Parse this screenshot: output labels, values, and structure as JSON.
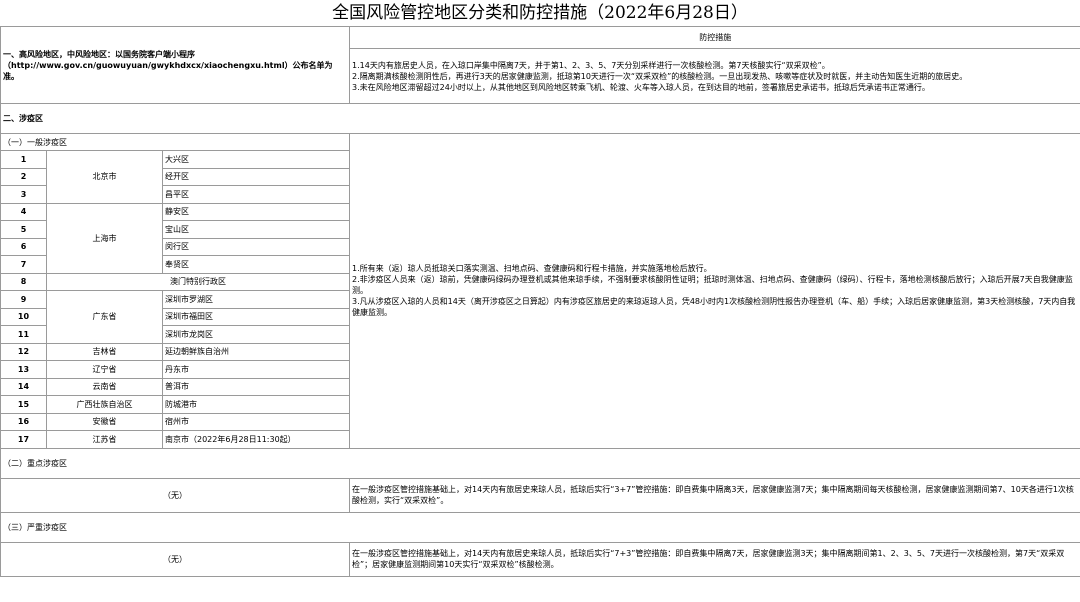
{
  "title": "全国风险管控地区分类和防控措施（2022年6月28日）",
  "measures_header": "防控措施",
  "high_risk": {
    "label": "一、高风险地区，中风险地区：以国务院客户端小程序（http://www.gov.cn/guowuyuan/gwykhdxcx/xiaochengxu.html）公布名单为准。",
    "measures": [
      "1.14天内有旅居史人员，在入琼口岸集中隔离7天，并于第1、2、3、5、7天分别采样进行一次核酸检测。第7天核酸实行“双采双检”。",
      "2.隔离期满核酸检测阴性后，再进行3天的居家健康监测，抵琼第10天进行一次“双采双检”的核酸检测。一旦出现发热、咳嗽等症状及时就医，并主动告知医生近期的旅居史。",
      "3.未在风险地区滞留超过24小时以上，从其他地区到风险地区转乘飞机、轮渡、火车等入琼人员，在到达目的地前，签署旅居史承诺书，抵琼后凭承诺书正常通行。"
    ]
  },
  "section2": {
    "label": "二、涉疫区",
    "general": {
      "label": "（一）一般涉疫区",
      "rows": [
        {
          "no": "1",
          "prov": "北京市",
          "area": "大兴区"
        },
        {
          "no": "2",
          "prov": "",
          "area": "经开区"
        },
        {
          "no": "3",
          "prov": "",
          "area": "昌平区"
        },
        {
          "no": "4",
          "prov": "上海市",
          "area": "静安区"
        },
        {
          "no": "5",
          "prov": "",
          "area": "宝山区"
        },
        {
          "no": "6",
          "prov": "",
          "area": "闵行区"
        },
        {
          "no": "7",
          "prov": "",
          "area": "奉贤区"
        },
        {
          "no": "8",
          "prov": "澳门特别行政区",
          "area": ""
        },
        {
          "no": "9",
          "prov": "广东省",
          "area": "深圳市罗湖区"
        },
        {
          "no": "10",
          "prov": "",
          "area": "深圳市福田区"
        },
        {
          "no": "11",
          "prov": "",
          "area": "深圳市龙岗区"
        },
        {
          "no": "12",
          "prov": "吉林省",
          "area": "延边朝鲜族自治州"
        },
        {
          "no": "13",
          "prov": "辽宁省",
          "area": "丹东市"
        },
        {
          "no": "14",
          "prov": "云南省",
          "area": "普洱市"
        },
        {
          "no": "15",
          "prov": "广西壮族自治区",
          "area": "防城港市"
        },
        {
          "no": "16",
          "prov": "安徽省",
          "area": "宿州市"
        },
        {
          "no": "17",
          "prov": "江苏省",
          "area": "南京市（2022年6月28日11:30起）"
        }
      ],
      "measures": [
        "1.所有来（返）琼人员抵琼关口落实测温、扫地点码、查健康码和行程卡措施，并实施落地检后放行。",
        "2.非涉疫区人员来（返）琼前，凭健康码绿码办理登机或其他来琼手续，不强制要求核酸阴性证明；抵琼时测体温、扫地点码、查健康码（绿码）、行程卡，落地检测核酸后放行；入琼后开展7天自我健康监测。",
        "3.凡从涉疫区入琼的人员和14天（离开涉疫区之日算起）内有涉疫区旅居史的来琼返琼人员，凭48小时内1次核酸检测阴性报告办理登机（车、船）手续；入琼后居家健康监测，第3天检测核酸，7天内自我健康监测。"
      ]
    },
    "key": {
      "label": "（二）重点涉疫区",
      "none": "（无）",
      "measure": "在一般涉疫区管控措施基础上，对14天内有旅居史来琼人员，抵琼后实行“3+7”管控措施：即自费集中隔离3天，居家健康监测7天；集中隔离期间每天核酸检测，居家健康监测期间第7、10天各进行1次核酸检测，实行“双采双检”。"
    },
    "severe": {
      "label": "（三）严重涉疫区",
      "none": "（无）",
      "measure": "在一般涉疫区管控措施基础上，对14天内有旅居史来琼人员，抵琼后实行“7+3”管控措施：即自费集中隔离7天，居家健康监测3天；集中隔离期间第1、2、3、5、7天进行一次核酸检测，第7天“双采双检”；居家健康监测期间第10天实行“双采双检”核酸检测。"
    }
  }
}
